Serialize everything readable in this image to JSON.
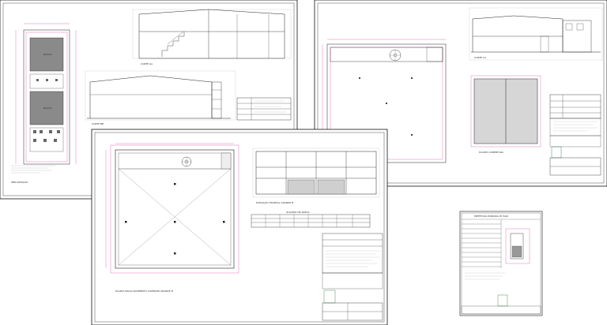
{
  "sheets": [
    {
      "id": "sheet-1",
      "labels": {
        "site_plan": "IMPLANTAÇÃO",
        "block_a": "BLOCO",
        "block_b": "BLOCO",
        "section_a": "CORTE AA",
        "section_b": "CORTE BB"
      }
    },
    {
      "id": "sheet-2",
      "labels": {
        "section": "CORTE CC",
        "cover_plan": "PLANTA COBERTURA"
      }
    },
    {
      "id": "sheet-3",
      "labels": {
        "plan": "PLANTA BAIXA PAVIMENTO SUPERIOR GRANDE B",
        "facade": "ELEVAÇÃO FRONTAL GRANDE B",
        "table_title": "QUADRO DE ÁREAS"
      }
    },
    {
      "id": "sheet-4",
      "labels": {
        "title": "PREFEITURA MUNICIPAL DE ITAJAÍ"
      }
    }
  ],
  "colors": {
    "line": "#222222",
    "dim": "#d0208a",
    "sheet": "#ffffff",
    "frame": "#111111"
  }
}
